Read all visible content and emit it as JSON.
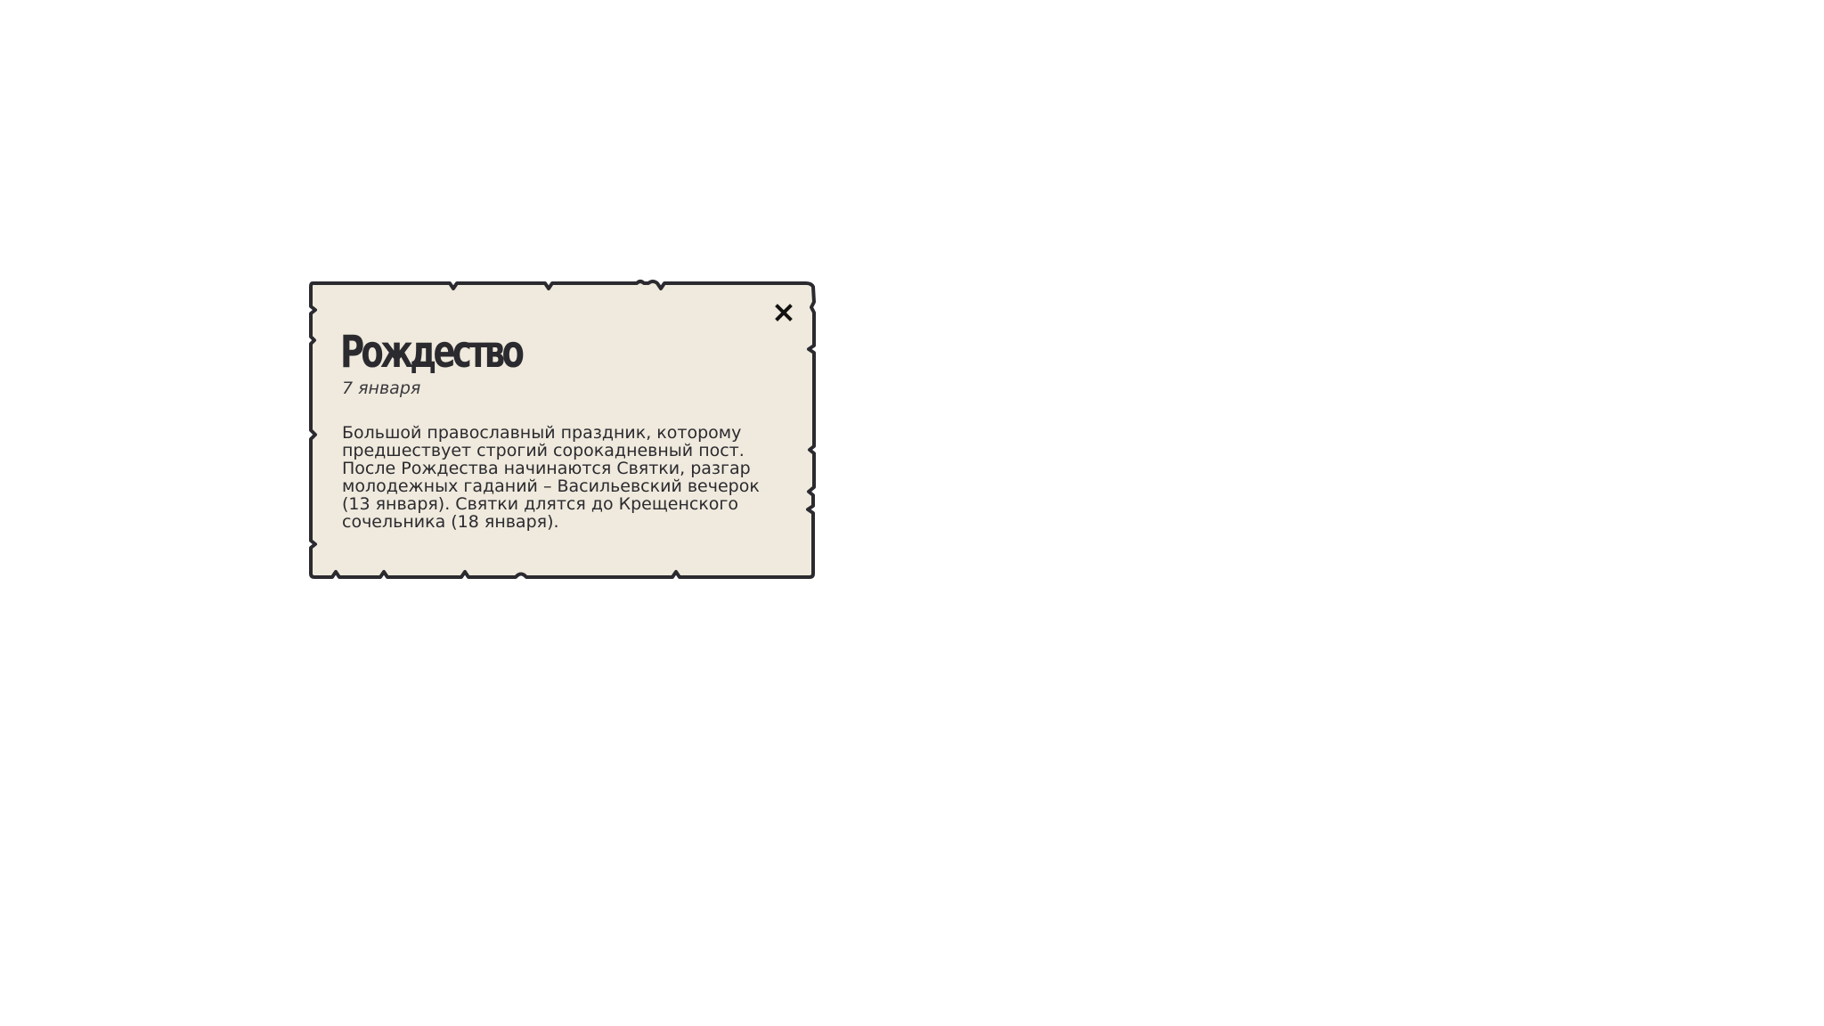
{
  "colors": {
    "page_background": "#ffffff",
    "card_background": "#efeadd",
    "card_border": "#2b2a2f",
    "text": "#2b2a2f"
  },
  "popup": {
    "title": "Рождество",
    "date": "7 января",
    "description": "Большой православный праздник, которому предшествует строгий сорокадневный пост. После Рождества начинаются Святки, разгар молодежных гаданий – Васильевский вечерок (13 января). Святки длятся до Крещенского сочельника (18 января).",
    "close_icon": "close-icon"
  }
}
